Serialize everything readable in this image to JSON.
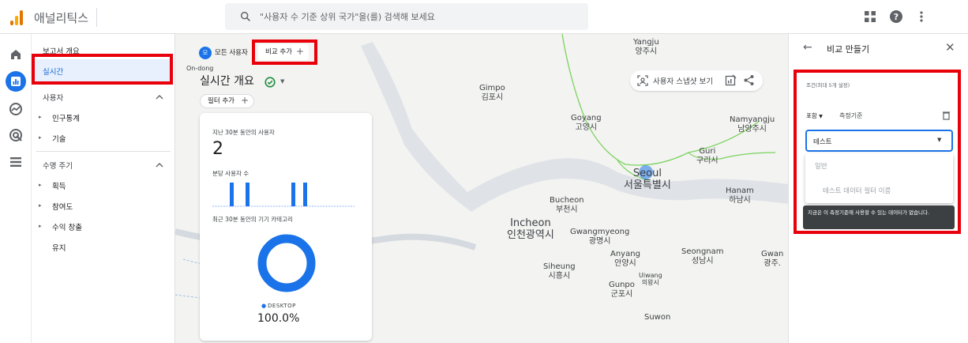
{
  "app": {
    "title": "애널리틱스"
  },
  "search": {
    "placeholder": "\"사용자 수 기준 상위 국가\"을(를) 검색해 보세요"
  },
  "nav": {
    "overview": "보고서 개요",
    "realtime": "실시간",
    "users_section": "사용자",
    "demographics": "인구통계",
    "tech": "기술",
    "lifecycle_section": "수명 주기",
    "acquisition": "획득",
    "engagement": "참여도",
    "monetization": "수익 창출",
    "retention": "유지"
  },
  "map": {
    "compare_chip": {
      "badge": "모",
      "label": "모든 사용자"
    },
    "add_compare": "비교 추가",
    "page_title": "실시간 개요",
    "add_filter": "필터 추가",
    "snapshot": "사용자 스냅샷 보기",
    "places": [
      {
        "en": "Yangju",
        "ko": "양주시"
      },
      {
        "en": "Gimpo",
        "ko": "김포시"
      },
      {
        "en": "Goyang",
        "ko": "고양시"
      },
      {
        "en": "Namyangju",
        "ko": "남양주시"
      },
      {
        "en": "Guri",
        "ko": "구리시"
      },
      {
        "en": "Seoul",
        "ko": "서울특별시"
      },
      {
        "en": "Hanam",
        "ko": "하남시"
      },
      {
        "en": "Bucheon",
        "ko": "부천시"
      },
      {
        "en": "Incheon",
        "ko": "인천광역시"
      },
      {
        "en": "Gwangmyeong",
        "ko": "광명시"
      },
      {
        "en": "Anyang",
        "ko": "안양시"
      },
      {
        "en": "Seongnam",
        "ko": "성남시"
      },
      {
        "en": "Gwan",
        "ko": "광주."
      },
      {
        "en": "Siheung",
        "ko": "시흥시"
      },
      {
        "en": "Uiwang",
        "ko": "의왕시"
      },
      {
        "en": "Gunpo",
        "ko": "군포시"
      },
      {
        "en": "Suwon",
        "ko": ""
      },
      {
        "en": "On-dong",
        "ko": ""
      }
    ]
  },
  "card": {
    "users_label": "지난 30분 동안의 사용자",
    "users_value": "2",
    "per_minute_label": "분당 사용자 수",
    "device_label": "최근 30분 동안의 기기 카테고리",
    "legend_label": "DESKTOP",
    "legend_value": "100.0%",
    "bar_values": [
      1,
      1,
      0,
      1,
      1
    ],
    "desktop_share": 1.0,
    "accent": "#1a73e8"
  },
  "panel": {
    "title": "비교 만들기",
    "condition_label": "조건(최대 5개 설정)",
    "include_label": "포함",
    "dimension_label": "측정기준",
    "dropdown_value": "테스트",
    "option_general": "일반",
    "option_test_filter": "테스트 데이터 필터 이름",
    "tooltip": "지금은 이 측정기준에 사용할 수 있는 데이터가 없습니다."
  },
  "colors": {
    "highlight": "#e8000b",
    "accent": "#1a73e8",
    "nav_selected_bg": "#e8f0fe"
  }
}
